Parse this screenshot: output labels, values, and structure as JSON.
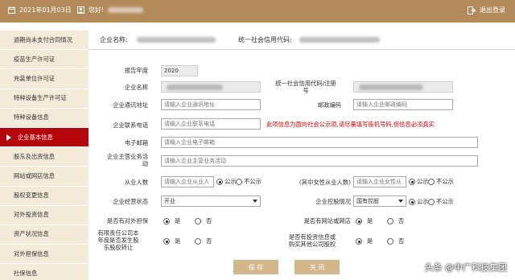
{
  "topbar": {
    "date": "2021年01月03日",
    "greeting": "您好!",
    "logout": "退出登录"
  },
  "sidebar": {
    "items": [
      {
        "label": "逾期尚未支付合同情况",
        "active": false
      },
      {
        "label": "疫苗生产许可证",
        "active": false
      },
      {
        "label": "充装单位许可证",
        "active": false
      },
      {
        "label": "特种设备生产许可证",
        "active": false
      },
      {
        "label": "特种设备信息",
        "active": false
      },
      {
        "label": "企业基本信息",
        "active": true
      },
      {
        "label": "股东及出资信息",
        "active": false
      },
      {
        "label": "网站或网店信息",
        "active": false
      },
      {
        "label": "股权变更信息",
        "active": false
      },
      {
        "label": "对外投资信息",
        "active": false
      },
      {
        "label": "资产状况信息",
        "active": false
      },
      {
        "label": "对外担保信息",
        "active": false
      },
      {
        "label": "社保信息",
        "active": false
      }
    ]
  },
  "header": {
    "company_name_label": "企业名称:",
    "credit_code_label": "统一社会信用代码:"
  },
  "form": {
    "report_year_label": "报告年度",
    "report_year_value": "2020",
    "company_name_label": "企业名称",
    "credit_code_label_1": "统一社会信用代码/注册",
    "credit_code_label_2": "号",
    "address_label": "企业通讯地址",
    "address_placeholder": "请输入企业通讯地址",
    "postcode_label": "邮政编码",
    "postcode_placeholder": "请输入企业邮政编码",
    "phone_label": "企业联系电话",
    "phone_placeholder": "请输入企业联系电话",
    "phone_warning": "此项信息为面向社会公示项,请尽量填写座机号码,但信息必须真实",
    "email_label": "电子邮箱",
    "email_placeholder": "请输入企业电子邮箱",
    "business_label_1": "企业主营业务活",
    "business_label_2": "动",
    "business_placeholder": "请输入企业主营业务活动",
    "employees_label": "从业人数",
    "employees_placeholder": "请输入企业从业人",
    "female_employees_label": "(其中女性从业人数)",
    "female_employees_placeholder": "请输入企业女性从",
    "status_label": "企业经营状态",
    "status_value": "开业",
    "holding_label": "企业控股情况",
    "holding_value": "国有控股",
    "guarantee_label": "是否有对外担保",
    "website_label": "是否有网站或网店",
    "llc_label_1": "有限责任公司本",
    "llc_label_2": "年度是否发生股",
    "llc_label_3": "东股权转让",
    "invest_label_1": "是否有投资信息或",
    "invest_label_2": "购买其他公司股权",
    "public": "公示",
    "not_public": "不公示",
    "yes": "是",
    "no": "否"
  },
  "buttons": {
    "save": "保 存",
    "close": "关 闭"
  },
  "watermark": "头条 @中广科技集团",
  "colors": {
    "topbar": "#b38b5a",
    "sidebar_bg": "#f3ead9",
    "active": "#b5060c",
    "button": "#d3b68a",
    "warning": "#e00000"
  }
}
